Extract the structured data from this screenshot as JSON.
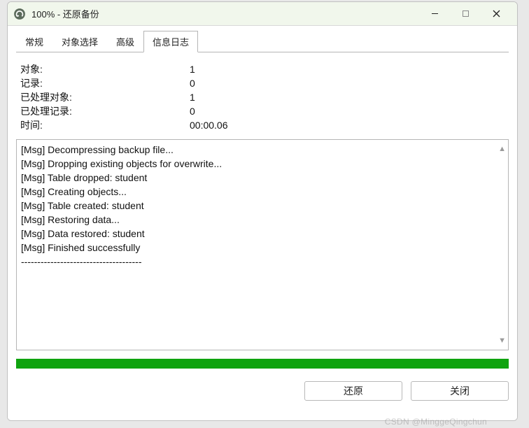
{
  "window": {
    "title": "100% - 还原备份"
  },
  "tabs": [
    {
      "label": "常规",
      "active": false
    },
    {
      "label": "对象选择",
      "active": false
    },
    {
      "label": "高级",
      "active": false
    },
    {
      "label": "信息日志",
      "active": true
    }
  ],
  "stats": {
    "objects": {
      "label": "对象:",
      "value": "1"
    },
    "records": {
      "label": "记录:",
      "value": "0"
    },
    "processed_objects": {
      "label": "已处理对象:",
      "value": "1"
    },
    "processed_records": {
      "label": "已处理记录:",
      "value": "0"
    },
    "time": {
      "label": "时间:",
      "value": "00:00.06"
    }
  },
  "log_lines": [
    "[Msg] Decompressing backup file...",
    "[Msg] Dropping existing objects for overwrite...",
    "[Msg] Table dropped: student",
    "[Msg] Creating objects...",
    "[Msg] Table created: student",
    "[Msg] Restoring data...",
    "[Msg] Data restored: student",
    "[Msg] Finished successfully",
    "-------------------------------------"
  ],
  "progress": {
    "percent": 100,
    "color": "#0fa30f"
  },
  "buttons": {
    "restore": "还原",
    "close": "关闭"
  },
  "watermark": "CSDN @MinggeQingchun"
}
